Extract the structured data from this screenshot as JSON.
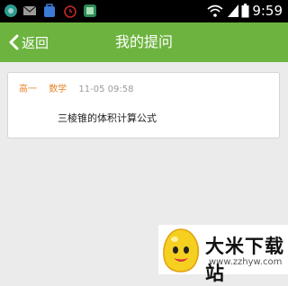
{
  "status_bar": {
    "time": "9:59",
    "icons": [
      "app-circle-icon",
      "mail-icon",
      "bag-icon",
      "alarm-icon",
      "app-square-icon",
      "wifi-icon",
      "signal-icon",
      "battery-icon"
    ]
  },
  "header": {
    "back_label": "返回",
    "title": "我的提问"
  },
  "questions": [
    {
      "grade": "高一",
      "subject": "数学",
      "time": "11-05 09:58",
      "text": "三棱锥的体积计算公式"
    }
  ],
  "watermark": {
    "name": "大米下载站",
    "url": "www.zzhyw.com"
  },
  "colors": {
    "accent": "#6db33f",
    "tag": "#e8842c",
    "background": "#ebebeb"
  }
}
